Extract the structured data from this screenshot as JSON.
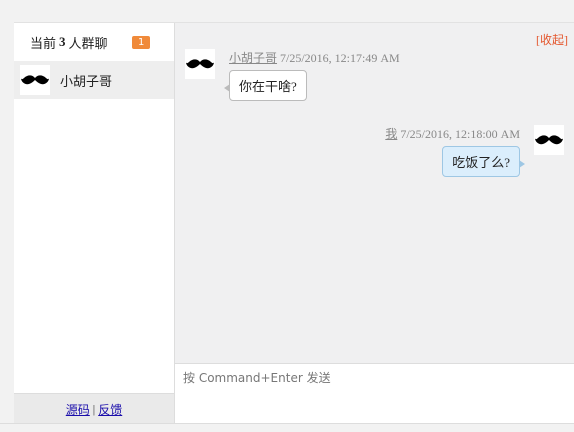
{
  "sidebar": {
    "header_prefix": "当前",
    "member_count": "3",
    "header_suffix": "人群聊",
    "unread_badge": "1",
    "users": [
      {
        "name": "小胡子哥",
        "icon": "mustache-icon"
      }
    ],
    "footer": {
      "source_link": "源码",
      "separator": "|",
      "feedback_link": "反馈"
    }
  },
  "chat": {
    "collapse_label": "[收起]",
    "messages": [
      {
        "side": "left",
        "user": "小胡子哥",
        "time": "7/25/2016, 12:17:49 AM",
        "text": "你在干啥?"
      },
      {
        "side": "right",
        "user": "我",
        "time": "7/25/2016, 12:18:00 AM",
        "text": "吃饭了么?"
      }
    ]
  },
  "input": {
    "placeholder": "按 Command+Enter 发送",
    "value": ""
  },
  "colors": {
    "badge": "#f08a3a",
    "collapse": "#e4572e",
    "my_bubble": "#dbeefc"
  }
}
